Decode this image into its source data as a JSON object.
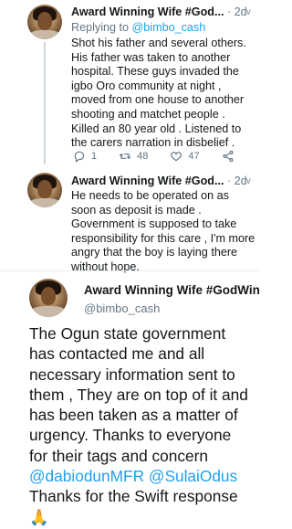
{
  "tweet1": {
    "author_name": "Award Winning Wife #God...",
    "time": "· 2d",
    "replying_prefix": "Replying to ",
    "replying_handle": "@bimbo_cash",
    "lines": [
      "Shot his father and several others.",
      "His father was taken to another",
      "hospital. These guys invaded the",
      "igbo Oro community at night ,",
      "moved from one house to another",
      "shooting and matchet people .",
      "Killed an 80 year old . Listened to",
      "the carers narration in disbelief ."
    ],
    "replies": "1",
    "retweets": "48",
    "likes": "47"
  },
  "tweet2": {
    "author_name": "Award Winning Wife #God...",
    "time": "· 2d",
    "lines": [
      "He needs to be operated on as",
      "soon as deposit is made .",
      "Government is supposed to take",
      "responsibility for this care , I'm more",
      "angry that the boy is laying there",
      "without hope."
    ]
  },
  "main_tweet": {
    "author_name": "Award Winning Wife #GodWin",
    "handle": "@bimbo_cash",
    "text_part1": "The Ogun state government has contacted me and all necessary information sent to them , They are on top of it and has been taken as a matter of urgency. Thanks to everyone for their tags and concern ",
    "mention1": "@dabiodunMFR",
    "space": " ",
    "mention2": "@SulaiOdus",
    "text_part2": " Thanks for the Swift response ",
    "emoji": "🙏"
  },
  "colors": {
    "link": "#1da1f2",
    "secondary": "#657786",
    "thread_line": "#ccd6dd"
  }
}
